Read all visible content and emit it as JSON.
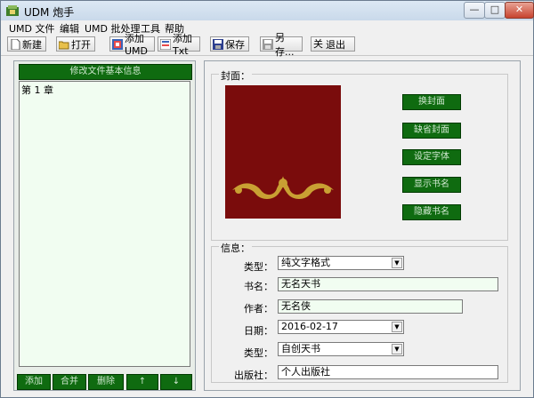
{
  "window": {
    "title": "UDM 炮手",
    "min": "—",
    "max": "□",
    "close": "✕"
  },
  "menu": [
    "UMD 文件",
    "编辑",
    "UMD 批处理",
    "工具",
    "帮助"
  ],
  "toolbar": {
    "new": "新建",
    "open": "打开",
    "add_umd": "添加UMD",
    "add_txt": "添加Txt",
    "save": "保存",
    "save_as": "另存...",
    "exit": "退出"
  },
  "left": {
    "header": "修改文件基本信息",
    "chapters": [
      "第 1 章"
    ],
    "buttons": {
      "add": "添加",
      "merge": "合并",
      "delete": "删除",
      "up": "↑",
      "down": "↓"
    }
  },
  "cover": {
    "legend": "封面：",
    "change": "换封面",
    "default": "缺省封面",
    "font": "设定字体",
    "show_title": "显示书名",
    "hide_title": "隐藏书名"
  },
  "info": {
    "legend": "信息：",
    "type_label": "类型：",
    "type_value": "纯文字格式",
    "name_label": "书名：",
    "name_value": "无名天书",
    "author_label": "作者：",
    "author_value": "无名侠",
    "date_label": "日期：",
    "date_value": "2016-02-17",
    "category_label": "类型：",
    "category_value": "自创天书",
    "publisher_label": "出版社：",
    "publisher_value": "个人出版社"
  },
  "colors": {
    "accent_green": "#0f6b10",
    "cover_red": "#7a0c0c",
    "ornament_gold": "#c9a033"
  },
  "icons": [
    "app-icon",
    "new-icon",
    "open-icon",
    "add-umd-icon",
    "add-txt-icon",
    "save-icon",
    "save-as-icon",
    "exit-icon"
  ]
}
